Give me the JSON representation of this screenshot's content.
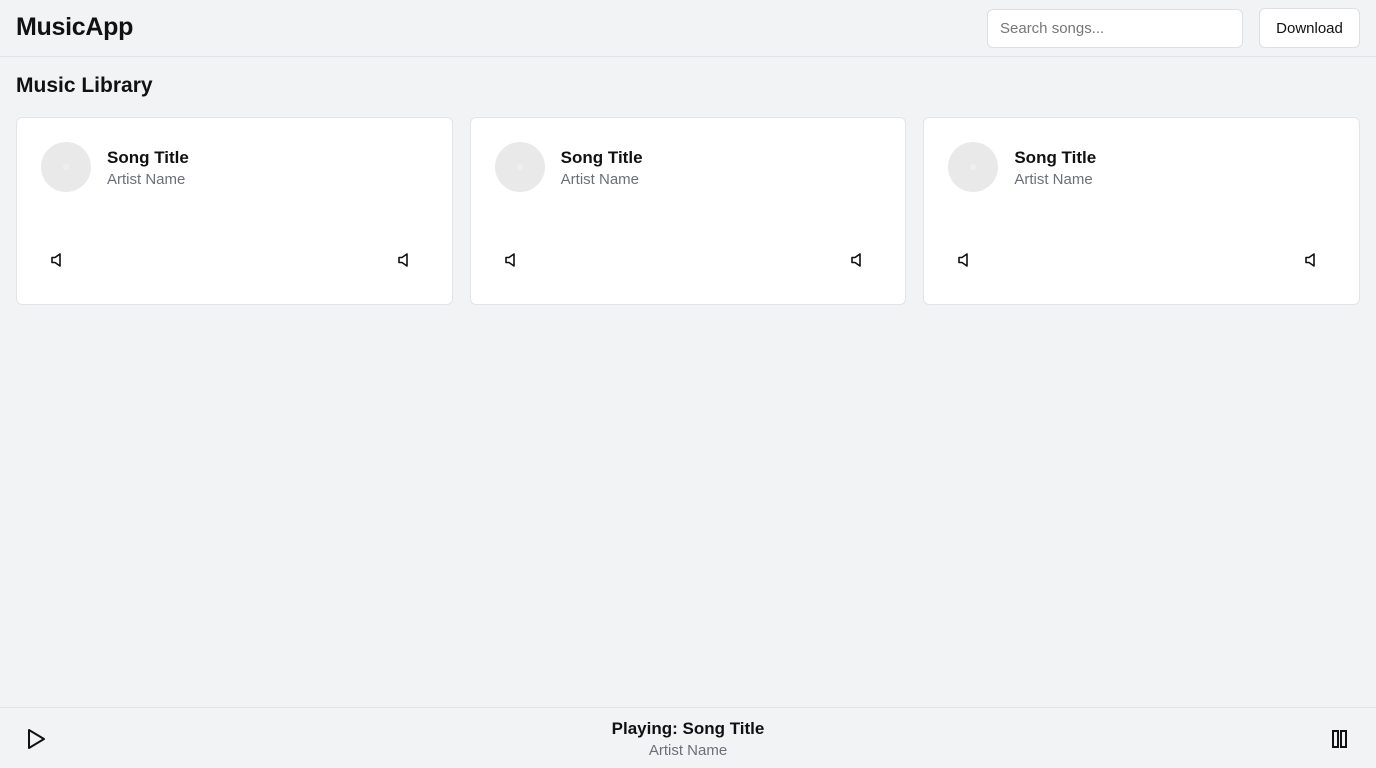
{
  "header": {
    "title": "MusicApp",
    "search_placeholder": "Search songs...",
    "download_label": "Download"
  },
  "main": {
    "title": "Music Library",
    "songs": [
      {
        "title": "Song Title",
        "artist": "Artist Name"
      },
      {
        "title": "Song Title",
        "artist": "Artist Name"
      },
      {
        "title": "Song Title",
        "artist": "Artist Name"
      }
    ]
  },
  "player": {
    "now_playing": "Playing: Song Title",
    "artist": "Artist Name"
  },
  "icons": {
    "volume": "volume-icon",
    "play": "play-icon",
    "pause": "pause-icon"
  }
}
